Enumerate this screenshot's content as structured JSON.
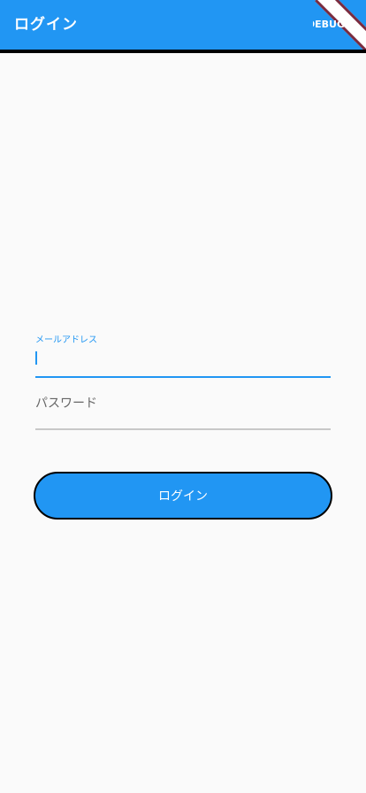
{
  "app_bar": {
    "title": "ログイン",
    "debug_banner_label": "DEBUG"
  },
  "login_form": {
    "email_label": "メールアドレス",
    "email_value": "",
    "password_hint": "パスワード",
    "password_value": "",
    "submit_label": "ログイン"
  },
  "colors": {
    "primary": "#2196f3",
    "background": "#fafafa",
    "debug_banner": "#7a2b3f"
  }
}
